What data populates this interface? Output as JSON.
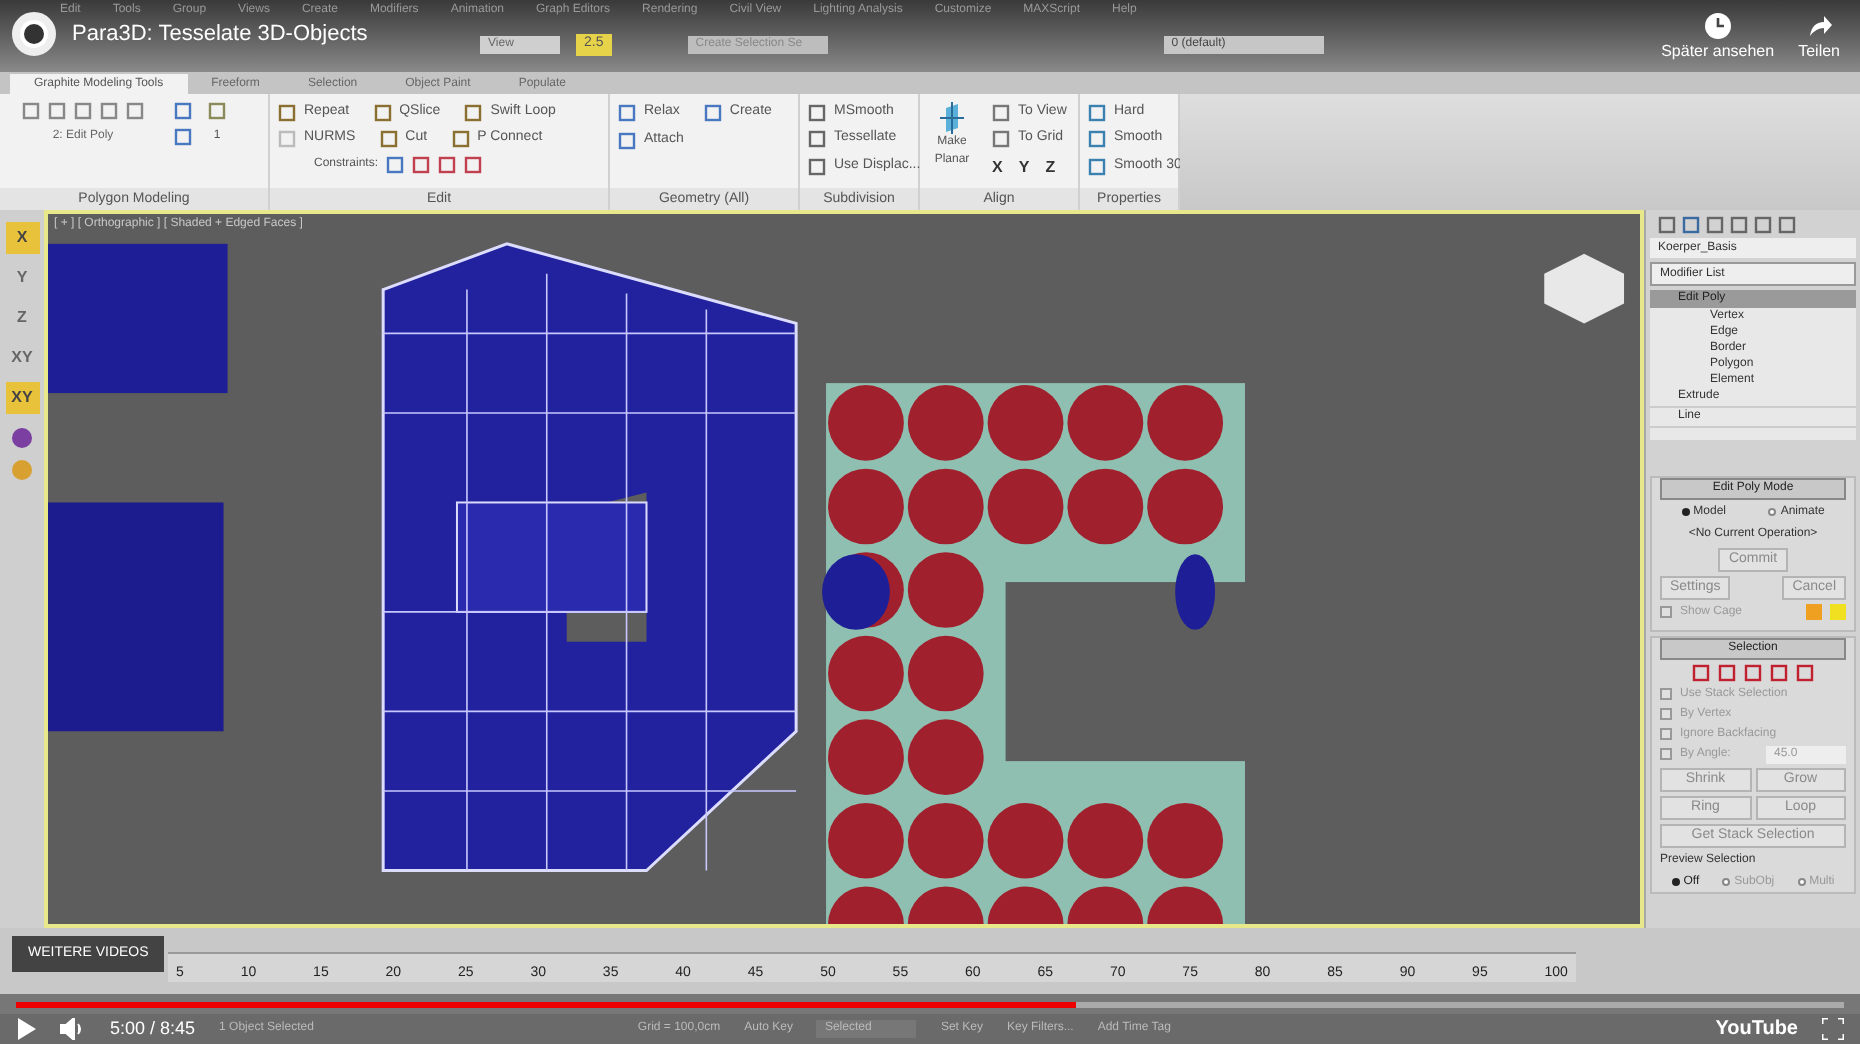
{
  "video": {
    "title": "Para3D: Tesselate 3D-Objects",
    "watch_later": "Später ansehen",
    "share": "Teilen",
    "more_videos": "WEITERE VIDEOS",
    "time": "5:00 / 8:45",
    "progress": {
      "level": 0.58
    },
    "logo": "YouTube"
  },
  "menu": [
    "Edit",
    "Tools",
    "Group",
    "Views",
    "Create",
    "Modifiers",
    "Animation",
    "Graph Editors",
    "Rendering",
    "Civil View",
    "Lighting Analysis",
    "Customize",
    "MAXScript",
    "Help"
  ],
  "toolbar": {
    "view_dropdown": "View",
    "snap_value": "2.5",
    "selection_set": "Create Selection Se",
    "layer": "0 (default)"
  },
  "ribbon_tabs": [
    {
      "label": "Graphite Modeling Tools",
      "selected": true
    },
    {
      "label": "Freeform",
      "selected": false
    },
    {
      "label": "Selection",
      "selected": false
    },
    {
      "label": "Object Paint",
      "selected": false
    },
    {
      "label": "Populate",
      "selected": false
    }
  ],
  "ribbon": {
    "polygon_modeling": {
      "stack_label": "2: Edit Poly",
      "spinner": "1",
      "footer": "Polygon Modeling"
    },
    "edit": {
      "rows": [
        [
          "Repeat",
          "QSlice",
          "Swift Loop"
        ],
        [
          "NURMS",
          "Cut",
          "P Connect"
        ]
      ],
      "constraints": "Constraints:",
      "footer": "Edit"
    },
    "geometry": {
      "items": [
        "Relax",
        "Create",
        "Attach"
      ],
      "footer": "Geometry (All)"
    },
    "subdivision": {
      "items": [
        "MSmooth",
        "Tessellate",
        "Use Displac..."
      ],
      "footer": "Subdivision"
    },
    "align": {
      "make_planar": "Make Planar",
      "items": [
        "To View",
        "To Grid"
      ],
      "axes": [
        "X",
        "Y",
        "Z"
      ],
      "footer": "Align"
    },
    "properties": {
      "items": [
        "Hard",
        "Smooth",
        "Smooth 30"
      ],
      "footer": "Properties"
    }
  },
  "axis_buttons": [
    {
      "label": "X",
      "selected": true
    },
    {
      "label": "Y",
      "selected": false
    },
    {
      "label": "Z",
      "selected": false
    },
    {
      "label": "XY",
      "selected": false
    },
    {
      "label": "XY",
      "selected": true
    }
  ],
  "viewport": {
    "label": "[ + ] [ Orthographic ] [ Shaded + Edged Faces ]"
  },
  "command_panel": {
    "object_name": "Koerper_Basis",
    "modifier_list": "Modifier List",
    "stack": [
      {
        "label": "Edit Poly",
        "selected": true,
        "children": [
          {
            "label": "Vertex"
          },
          {
            "label": "Edge"
          },
          {
            "label": "Border"
          },
          {
            "label": "Polygon"
          },
          {
            "label": "Element"
          }
        ]
      },
      {
        "label": "Extrude",
        "selected": false
      },
      {
        "label": "Line",
        "selected": false
      }
    ],
    "edit_poly_mode": {
      "title": "Edit Poly Mode",
      "modes": [
        {
          "label": "Model",
          "selected": true
        },
        {
          "label": "Animate",
          "selected": false
        }
      ],
      "operation": "<No Current Operation>",
      "commit": "Commit",
      "settings": "Settings",
      "cancel": "Cancel",
      "show_cage": {
        "label": "Show Cage",
        "checked": false
      }
    },
    "selection": {
      "title": "Selection",
      "options": [
        {
          "label": "Use Stack Selection",
          "checked": false
        },
        {
          "label": "By Vertex",
          "checked": false
        },
        {
          "label": "Ignore Backfacing",
          "checked": false
        },
        {
          "label": "By Angle:",
          "checked": false
        }
      ],
      "angle": "45.0",
      "buttons": [
        "Shrink",
        "Grow",
        "Ring",
        "Loop"
      ],
      "stack_button": "Get Stack Selection",
      "preview_title": "Preview Selection",
      "preview": [
        {
          "label": "Off",
          "selected": true
        },
        {
          "label": "SubObj",
          "selected": false
        },
        {
          "label": "Multi",
          "selected": false
        }
      ]
    }
  },
  "timeline": {
    "ticks": [
      "5",
      "10",
      "15",
      "20",
      "25",
      "30",
      "35",
      "40",
      "45",
      "50",
      "55",
      "60",
      "65",
      "70",
      "75",
      "80",
      "85",
      "90",
      "95",
      "100"
    ]
  },
  "status": {
    "selected": "1 Object Selected",
    "grid": "Grid = 100,0cm",
    "auto_key": "Auto Key",
    "key_mode": "Selected",
    "set_key": "Set Key",
    "key_filters": "Key Filters...",
    "time_tag": "Add Time Tag"
  }
}
